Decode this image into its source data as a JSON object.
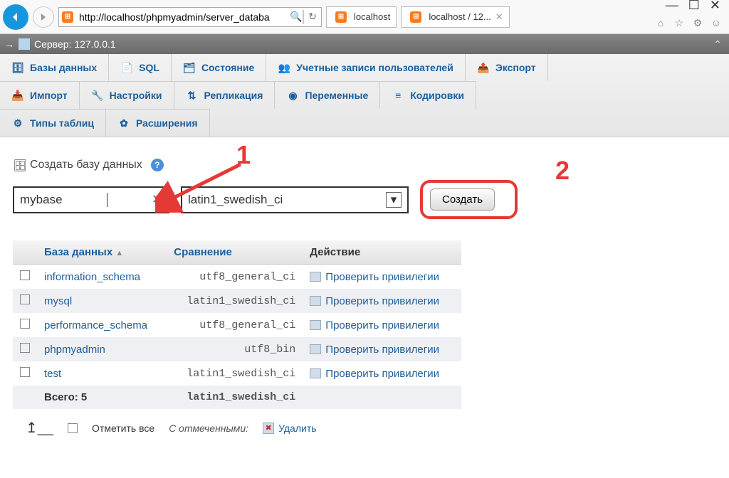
{
  "browser": {
    "url": "http://localhost/phpmyadmin/server_databa",
    "tabs": [
      {
        "label": "localhost"
      },
      {
        "label": "localhost / 12..."
      }
    ]
  },
  "breadcrumb": {
    "server_label": "Сервер: 127.0.0.1"
  },
  "nav": {
    "databases": "Базы данных",
    "sql": "SQL",
    "status": "Состояние",
    "accounts": "Учетные записи пользователей",
    "export": "Экспорт",
    "import": "Импорт",
    "settings": "Настройки",
    "replication": "Репликация",
    "variables": "Переменные",
    "encodings": "Кодировки",
    "tabletypes": "Типы таблиц",
    "extensions": "Расширения"
  },
  "create": {
    "heading": "Создать базу данных",
    "name_value": "mybase",
    "collation_value": "latin1_swedish_ci",
    "button": "Создать"
  },
  "annotations": {
    "one": "1",
    "two": "2"
  },
  "table": {
    "col_db": "База данных",
    "col_collation": "Сравнение",
    "col_action": "Действие",
    "action_label": "Проверить привилегии",
    "totals_label": "Всего: 5",
    "totals_collation": "latin1_swedish_ci",
    "rows": [
      {
        "name": "information_schema",
        "collation": "utf8_general_ci"
      },
      {
        "name": "mysql",
        "collation": "latin1_swedish_ci"
      },
      {
        "name": "performance_schema",
        "collation": "utf8_general_ci"
      },
      {
        "name": "phpmyadmin",
        "collation": "utf8_bin"
      },
      {
        "name": "test",
        "collation": "latin1_swedish_ci"
      }
    ]
  },
  "footer": {
    "check_all": "Отметить все",
    "with_selected": "С отмеченными:",
    "delete": "Удалить"
  }
}
